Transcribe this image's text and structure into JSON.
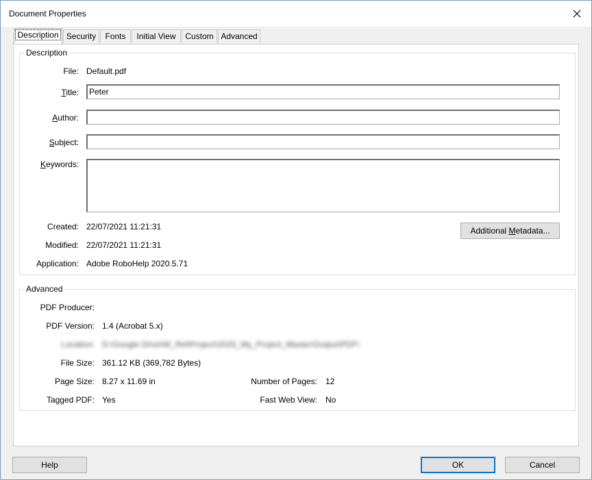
{
  "window": {
    "title": "Document Properties"
  },
  "tabs": [
    "Description",
    "Security",
    "Fonts",
    "Initial View",
    "Custom",
    "Advanced"
  ],
  "description": {
    "legend": "Description",
    "file_label": "File:",
    "file_value": "Default.pdf",
    "title_label": "Title:",
    "title_value": "Peter",
    "author_label": "Author:",
    "author_value": "",
    "subject_label": "Subject:",
    "subject_value": "",
    "keywords_label": "Keywords:",
    "keywords_value": "",
    "created_label": "Created:",
    "created_value": "22/07/2021 11:21:31",
    "modified_label": "Modified:",
    "modified_value": "22/07/2021 11:21:31",
    "application_label": "Application:",
    "application_value": "Adobe RoboHelp 2020.5.71",
    "metadata_button": "Additional Metadata..."
  },
  "advanced": {
    "legend": "Advanced",
    "producer_label": "PDF Producer:",
    "producer_value": "",
    "version_label": "PDF Version:",
    "version_value": "1.4 (Acrobat 5.x)",
    "location_label": "Location:",
    "location_value": "D:\\Google Drive\\W_Rel\\Project\\2020_My_Project_Master\\Output\\PDF\\",
    "filesize_label": "File Size:",
    "filesize_value": "361.12 KB (369,782 Bytes)",
    "pagesize_label": "Page Size:",
    "pagesize_value": "8.27 x 11.69 in",
    "numpages_label": "Number of Pages:",
    "numpages_value": "12",
    "tagged_label": "Tagged PDF:",
    "tagged_value": "Yes",
    "fastweb_label": "Fast Web View:",
    "fastweb_value": "No"
  },
  "buttons": {
    "help": "Help",
    "ok": "OK",
    "cancel": "Cancel"
  },
  "icons": {
    "close": "close-icon"
  }
}
